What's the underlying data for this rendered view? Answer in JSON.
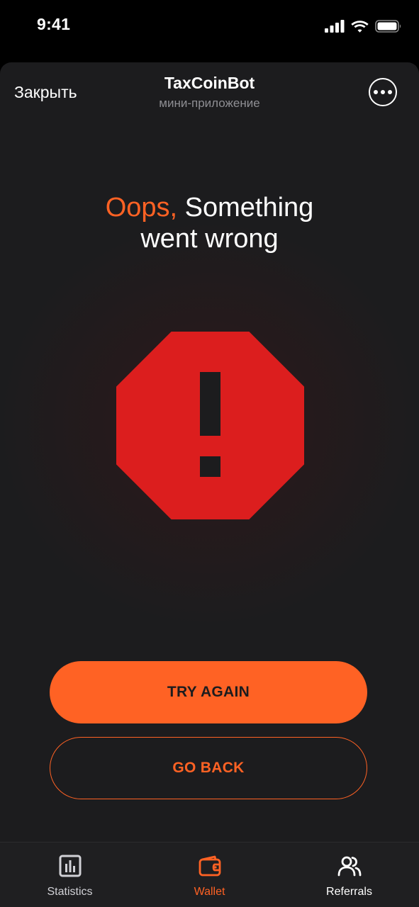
{
  "status_bar": {
    "time": "9:41"
  },
  "header": {
    "close_label": "Закрыть",
    "title": "TaxCoinBot",
    "subtitle": "мини-приложение",
    "menu_icon": "more-dots-icon"
  },
  "error": {
    "title_accent": "Oops,",
    "title_rest": " Something",
    "title_line2": "went wrong",
    "icon": "stop-warning-icon",
    "icon_color": "#dc1e1e"
  },
  "actions": {
    "try_again": "TRY AGAIN",
    "go_back": "GO BACK"
  },
  "tabs": [
    {
      "label": "Statistics",
      "icon": "statistics-icon",
      "active": false
    },
    {
      "label": "Wallet",
      "icon": "wallet-icon",
      "active": true
    },
    {
      "label": "Referrals",
      "icon": "referrals-icon",
      "active": false
    }
  ],
  "colors": {
    "accent": "#ff6224",
    "background": "#1c1c1e",
    "danger": "#dc1e1e"
  }
}
